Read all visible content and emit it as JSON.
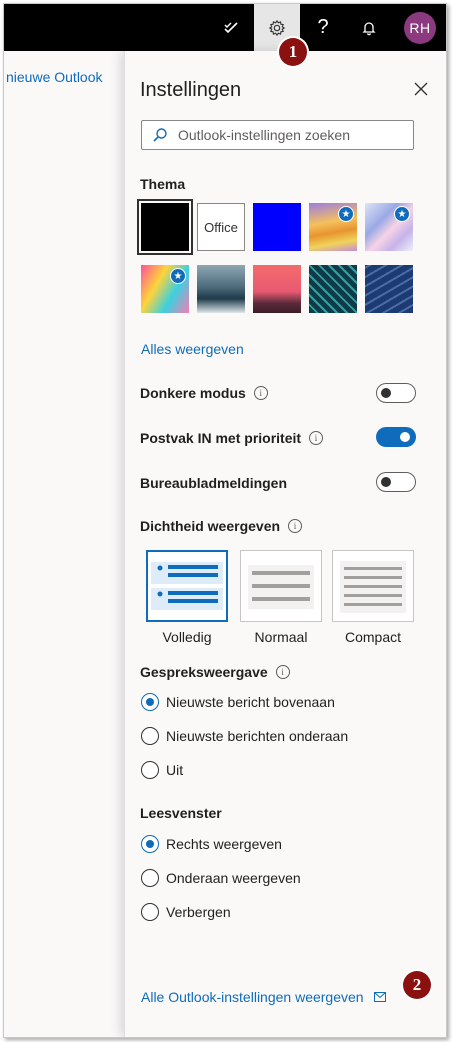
{
  "topbar": {
    "icons": [
      "checklist-icon",
      "gear-icon",
      "help-icon",
      "bell-icon"
    ],
    "help_glyph": "?",
    "avatar_initials": "RH"
  },
  "left_pane": {
    "link": "nieuwe Outlook"
  },
  "panel": {
    "title": "Instellingen",
    "search_placeholder": "Outlook-instellingen zoeken",
    "theme_heading": "Thema",
    "office_theme_label": "Office",
    "show_all_themes": "Alles weergeven",
    "toggles": [
      {
        "label": "Donkere modus",
        "on": false
      },
      {
        "label": "Postvak IN met prioriteit",
        "on": true
      },
      {
        "label": "Bureaubladmeldingen",
        "on": false
      }
    ],
    "density_heading": "Dichtheid weergeven",
    "density_options": [
      {
        "label": "Volledig",
        "selected": true
      },
      {
        "label": "Normaal",
        "selected": false
      },
      {
        "label": "Compact",
        "selected": false
      }
    ],
    "conversation_heading": "Gespreksweergave",
    "conversation_options": [
      {
        "label": "Nieuwste bericht bovenaan",
        "checked": true
      },
      {
        "label": "Nieuwste berichten onderaan",
        "checked": false
      },
      {
        "label": "Uit",
        "checked": false
      }
    ],
    "reading_pane_heading": "Leesvenster",
    "reading_pane_options": [
      {
        "label": "Rechts weergeven",
        "checked": true
      },
      {
        "label": "Onderaan weergeven",
        "checked": false
      },
      {
        "label": "Verbergen",
        "checked": false
      }
    ],
    "all_settings_link": "Alle Outlook-instellingen weergeven"
  },
  "callouts": {
    "first": "1",
    "second": "2"
  },
  "colors": {
    "accent": "#0f6cbd",
    "callout": "#8b1111",
    "avatar": "#8b3a80",
    "topbar": "#000000"
  }
}
